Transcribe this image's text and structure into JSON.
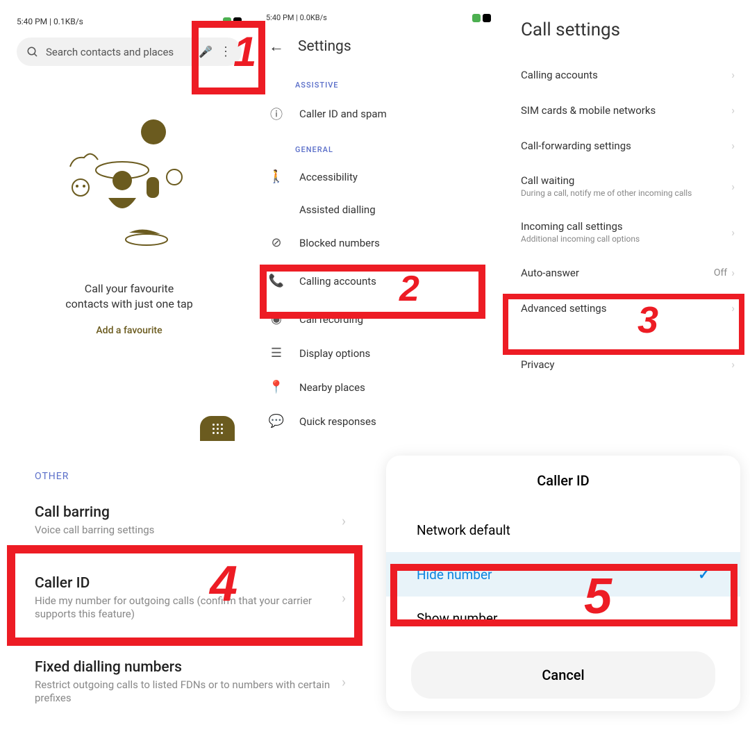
{
  "panel1": {
    "status_time": "5:40 PM | 0.1KB/s",
    "search_placeholder": "Search contacts and places",
    "fav_line1": "Call your favourite",
    "fav_line2": "contacts with just one tap",
    "add_fav": "Add a favourite"
  },
  "panel2": {
    "status_time": "5:40 PM | 0.0KB/s",
    "title": "Settings",
    "section1": "ASSISTIVE",
    "caller_id": "Caller ID and spam",
    "section2": "GENERAL",
    "accessibility": "Accessibility",
    "assisted": "Assisted dialling",
    "blocked": "Blocked numbers",
    "calling_accounts": "Calling accounts",
    "call_recording": "Call recording",
    "display": "Display options",
    "nearby": "Nearby places",
    "quick": "Quick responses"
  },
  "panel3": {
    "title": "Call settings",
    "calling_accounts": "Calling accounts",
    "sim": "SIM cards & mobile networks",
    "forwarding": "Call-forwarding settings",
    "waiting": "Call waiting",
    "waiting_sub": "During a call, notify me of other incoming calls",
    "incoming": "Incoming call settings",
    "incoming_sub": "Additional incoming call options",
    "auto": "Auto-answer",
    "auto_val": "Off",
    "advanced": "Advanced settings",
    "privacy": "Privacy"
  },
  "panel4": {
    "section": "OTHER",
    "barring": "Call barring",
    "barring_sub": "Voice call barring settings",
    "callerid": "Caller ID",
    "callerid_sub": "Hide my number for outgoing calls (confirm that your carrier supports this feature)",
    "fdn": "Fixed dialling numbers",
    "fdn_sub": "Restrict outgoing calls to listed FDNs or to numbers with certain prefixes"
  },
  "panel5": {
    "title": "Caller ID",
    "opt1": "Network default",
    "opt2": "Hide number",
    "opt3": "Show number",
    "cancel": "Cancel"
  },
  "nums": {
    "n1": "1",
    "n2": "2",
    "n3": "3",
    "n4": "4",
    "n5": "5"
  }
}
